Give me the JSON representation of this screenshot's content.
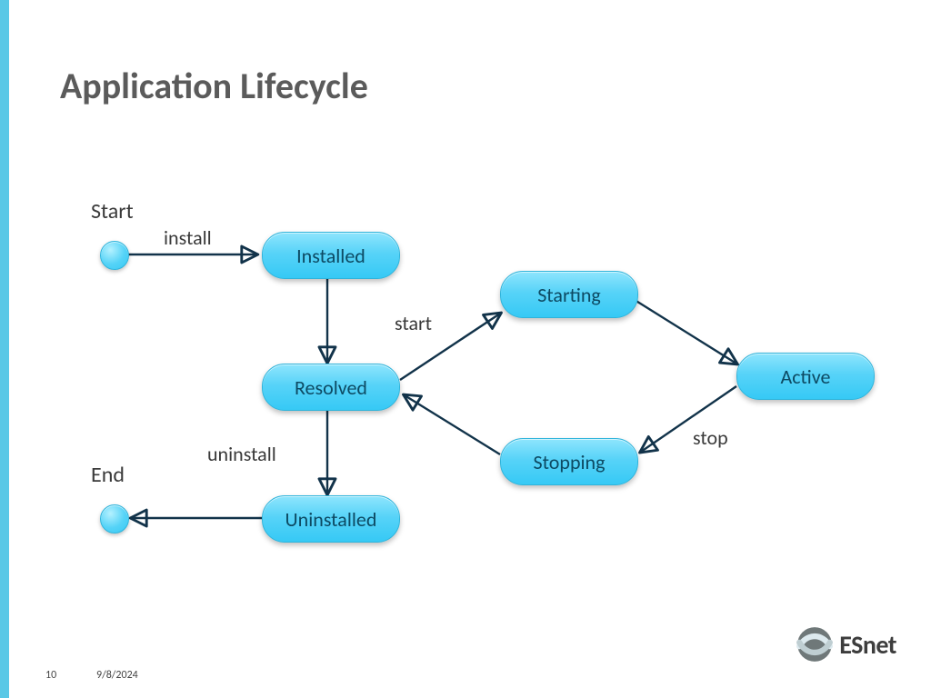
{
  "title": "Application Lifecycle",
  "footer": {
    "page": "10",
    "date": "9/8/2024"
  },
  "logo": {
    "text": "ESnet"
  },
  "labels": {
    "start": "Start",
    "end": "End"
  },
  "nodes": {
    "installed": "Installed",
    "resolved": "Resolved",
    "uninstalled": "Uninstalled",
    "starting": "Starting",
    "stopping": "Stopping",
    "active": "Active"
  },
  "edges": {
    "install": "install",
    "start": "start",
    "stop": "stop",
    "uninstall": "uninstall"
  }
}
